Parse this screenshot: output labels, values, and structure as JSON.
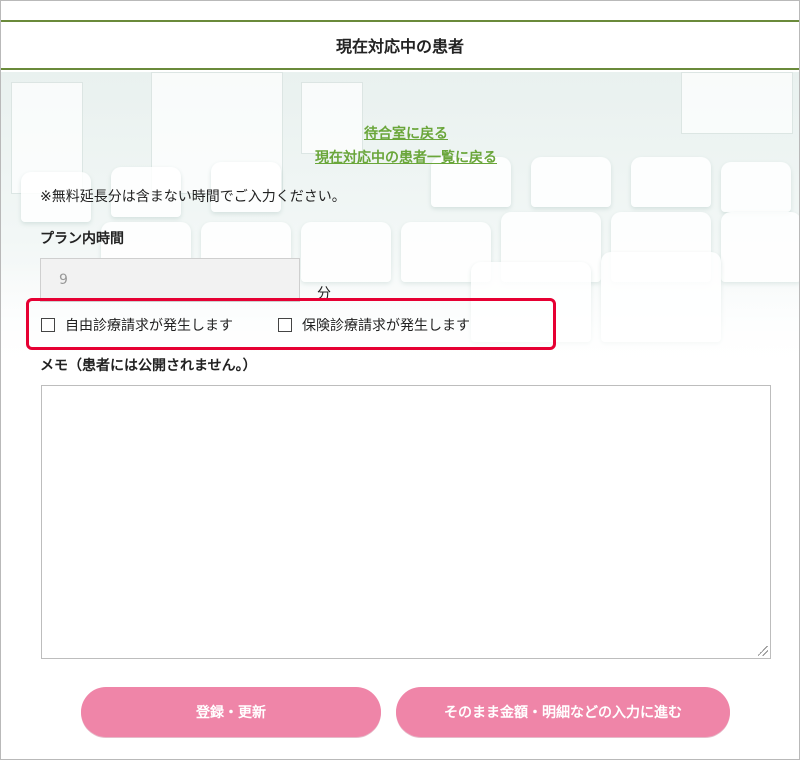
{
  "header": {
    "title": "現在対応中の患者"
  },
  "links": {
    "waiting_room": "待合室に戻る",
    "current_patients_list": "現在対応中の患者一覧に戻る"
  },
  "note": "※無料延長分は含まない時間でご入力ください。",
  "plan_time": {
    "label": "プラン内時間",
    "value": "9",
    "unit": "分"
  },
  "checkboxes": [
    {
      "label": "自由診療請求が発生します",
      "checked": false
    },
    {
      "label": "保険診療請求が発生します",
      "checked": false
    }
  ],
  "memo": {
    "label": "メモ（患者には公開されません。）",
    "value": ""
  },
  "buttons": {
    "register": "登録・更新",
    "proceed": "そのまま金額・明細などの入力に進む"
  },
  "colors": {
    "header_border": "#6a8a3a",
    "link": "#6aa63a",
    "button": "#ef85a8",
    "highlight": "#e60033"
  }
}
